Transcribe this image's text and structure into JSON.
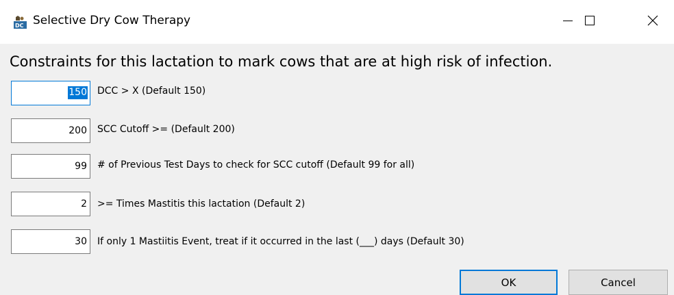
{
  "window": {
    "title": "Selective Dry Cow Therapy",
    "app_icon": "dc-app-icon",
    "controls": {
      "minimize_icon": "minimize-icon",
      "maximize_icon": "maximize-icon",
      "close_icon": "close-icon"
    }
  },
  "heading": "Constraints for this lactation to mark cows that are at high risk of infection.",
  "fields": [
    {
      "value": "150",
      "label": "DCC > X (Default 150)",
      "selected": true
    },
    {
      "value": "200",
      "label": "SCC Cutoff >= (Default 200)"
    },
    {
      "value": "99",
      "label": "# of Previous Test Days to check for SCC cutoff (Default 99 for all)"
    },
    {
      "value": "2",
      "label": ">= Times Mastitis this lactation (Default 2)"
    },
    {
      "value": "30",
      "label": "If only 1 Mastiitis Event, treat if it occurred in the last (___) days (Default 30)"
    }
  ],
  "buttons": {
    "ok": "OK",
    "cancel": "Cancel"
  },
  "colors": {
    "accent": "#0078d7",
    "background": "#f0f0f0"
  }
}
